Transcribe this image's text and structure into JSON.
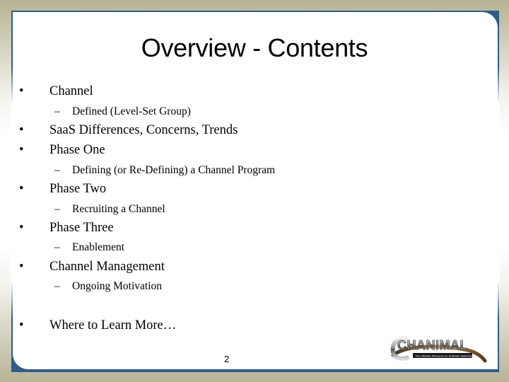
{
  "slide": {
    "title": "Overview - Contents",
    "page_number": "2",
    "bullet_glyph": "•",
    "sub_bullet_glyph": "–",
    "items": [
      {
        "level": 1,
        "text": "Channel"
      },
      {
        "level": 2,
        "text": "Defined (Level-Set Group)"
      },
      {
        "level": 1,
        "text": "SaaS Differences, Concerns, Trends"
      },
      {
        "level": 1,
        "text": "Phase One"
      },
      {
        "level": 2,
        "text": "Defining (or Re-Defining) a Channel Program"
      },
      {
        "level": 1,
        "text": "Phase Two"
      },
      {
        "level": 2,
        "text": "Recruiting a Channel"
      },
      {
        "level": 1,
        "text": "Phase Three"
      },
      {
        "level": 2,
        "text": "Enablement"
      },
      {
        "level": 1,
        "text": "Channel Management"
      },
      {
        "level": 2,
        "text": "Ongoing Motivation"
      },
      {
        "level": 1,
        "text": "Where to Learn More…"
      }
    ]
  },
  "logo": {
    "name": "CHANIMAL",
    "tagline": "The Ultimate Resource on Software Marketing"
  },
  "colors": {
    "frame_blue": "#2d5b8c",
    "background_tan": "#b7b395",
    "text": "#000000"
  }
}
